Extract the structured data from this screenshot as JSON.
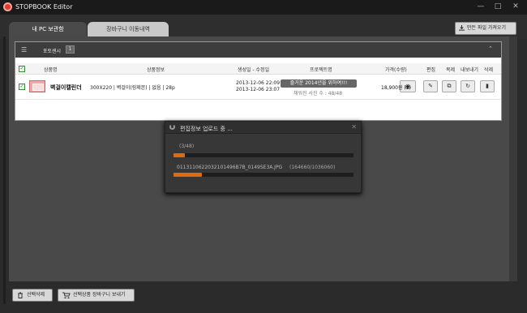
{
  "window": {
    "title": "STOPBOOK Editor",
    "minimize": "—",
    "maximize": "□",
    "close": "✕"
  },
  "tabs": [
    {
      "label": "내 PC 보관함"
    },
    {
      "label": "장바구니 이동내역"
    }
  ],
  "import_button": {
    "label": "만든 파일 가져오기"
  },
  "toolbar": {
    "list_icon": "☰",
    "dropdown_label": "포토센시",
    "dropdown_value": "1",
    "collapse_icon": "⌃"
  },
  "table": {
    "headers": [
      "상품명",
      "상품정보",
      "생성일 - 수정일",
      "프로젝트명",
      "가격(수량)",
      "편집",
      "복제",
      "내보내기",
      "삭제"
    ],
    "row": {
      "name": "벽걸이캘린더",
      "info": "300X220 | 벽걸이(링제본) | 없음 | 28p",
      "created": "2013-12-06 22:09",
      "modified": "2013-12-06 23:07",
      "project": "즐거운 2014년을 위하여!!!",
      "photo_count": "채워진 사진 수 : 48/48",
      "price": "18,900원 (1)",
      "preview_icon": "◉",
      "edit_icon": "✎",
      "duplicate_icon": "⧉",
      "export_icon": "↻",
      "delete_icon": "▮"
    }
  },
  "dialog": {
    "title": "편집정보 업로드 중 ...",
    "close": "✕",
    "count": "(3/48)",
    "file": "0113110622032101496B7B_0149SE3A.JPG",
    "bytes": "(164660/1036060)",
    "progress_total": 0.0625,
    "progress_file": 0.159
  },
  "footer": {
    "delete_selected": "선택삭제",
    "send_to_cart": "선택상품 장바구니 보내기"
  }
}
